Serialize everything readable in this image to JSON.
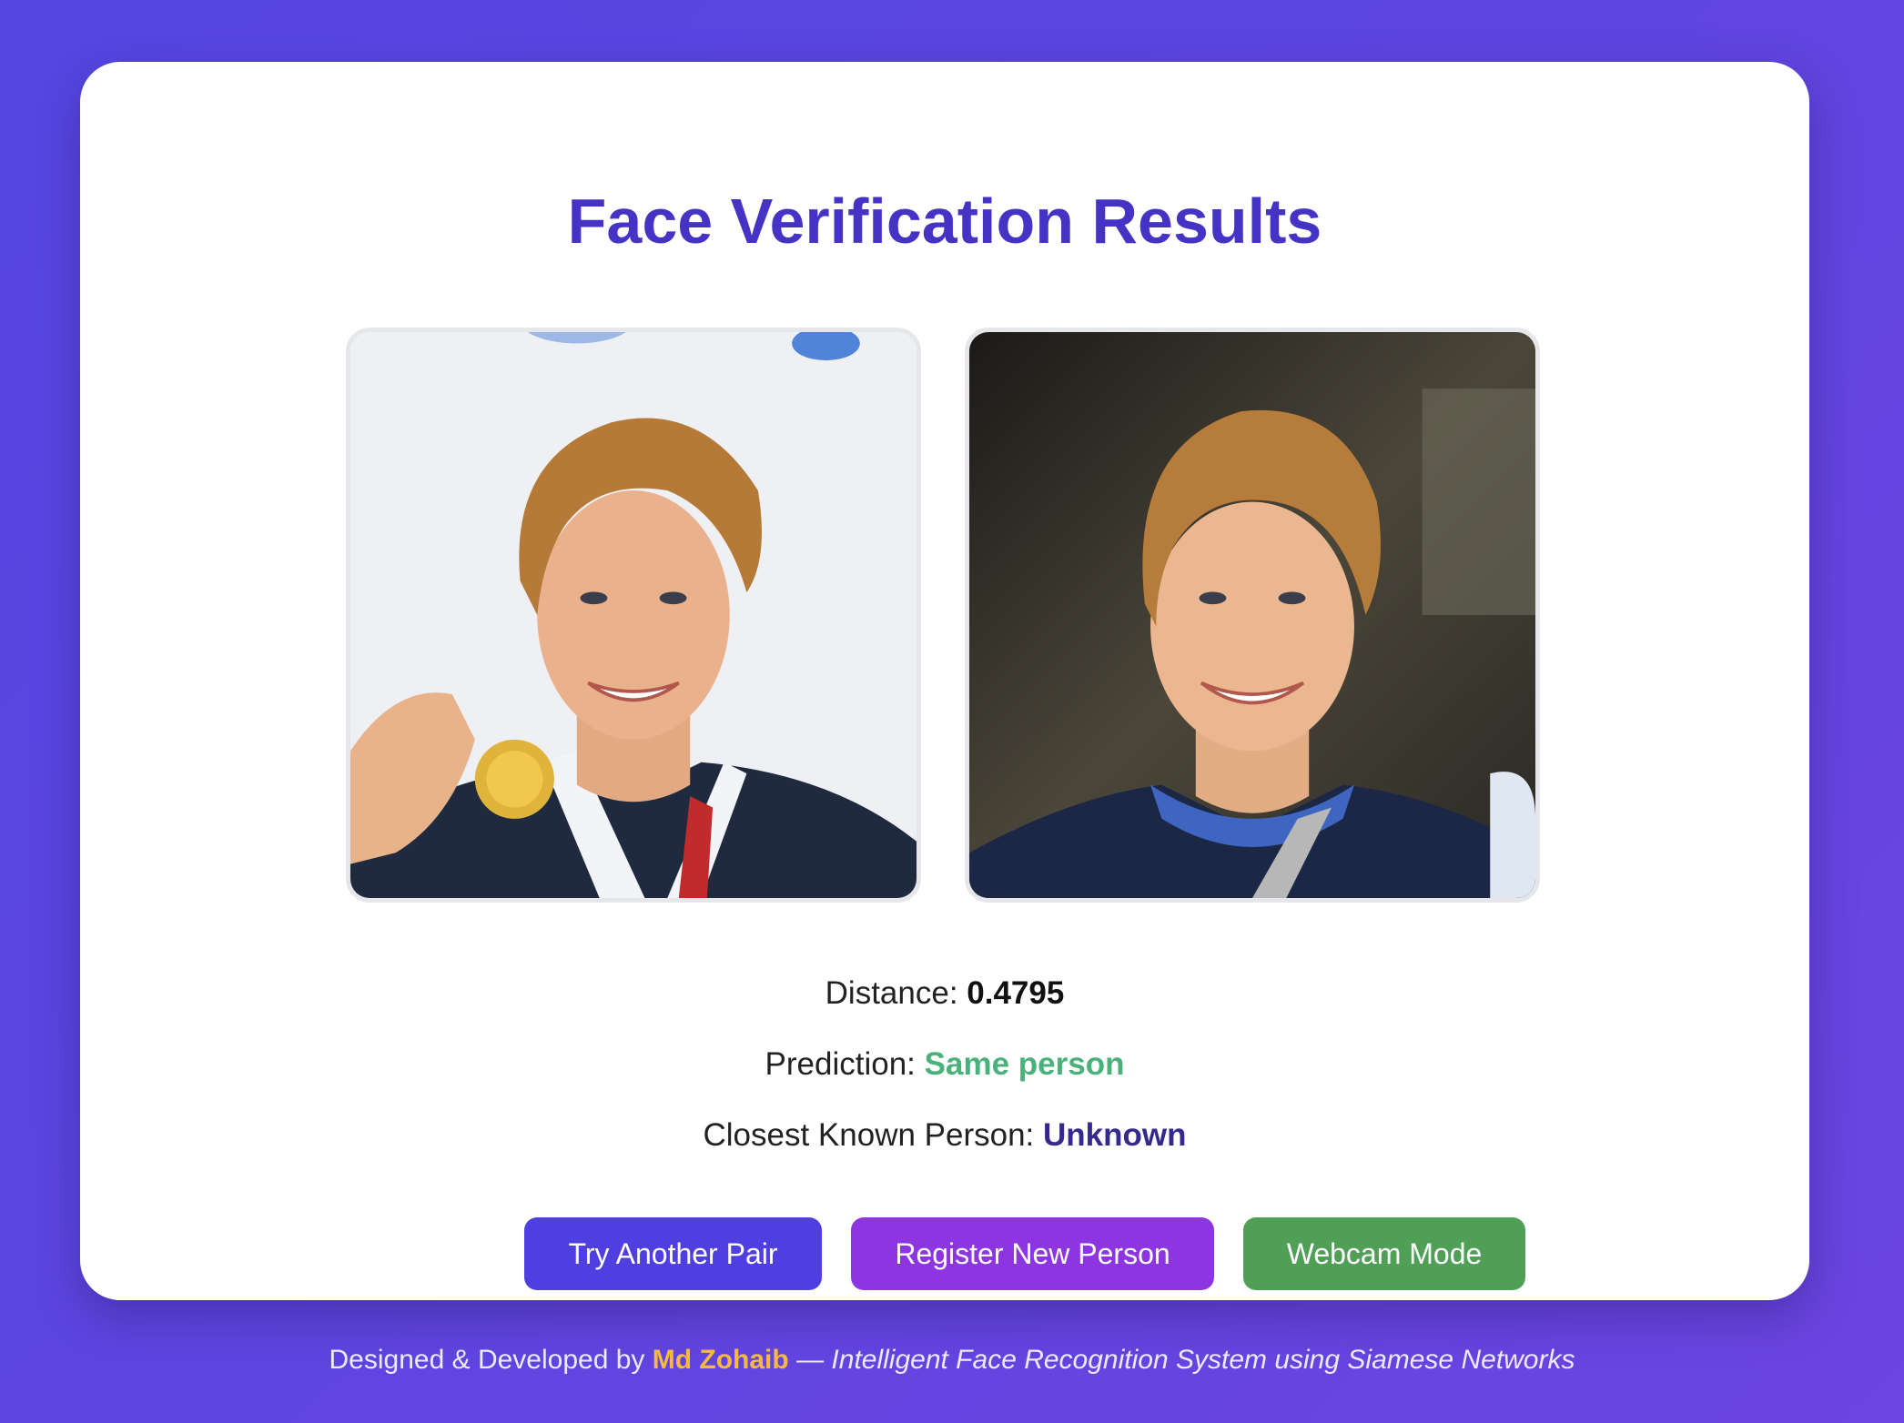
{
  "page": {
    "title": "Face Verification Results"
  },
  "images": {
    "left_alt": "Input face image 1",
    "right_alt": "Input face image 2"
  },
  "results": {
    "distance_label": "Distance:",
    "distance_value": "0.4795",
    "prediction_label": "Prediction:",
    "prediction_value": "Same person",
    "closest_label": "Closest Known Person:",
    "closest_value": "Unknown"
  },
  "actions": {
    "try_another": "Try Another Pair",
    "register_new": "Register New Person",
    "webcam_mode": "Webcam Mode"
  },
  "footer": {
    "prefix": "Designed & Developed by",
    "author": "Md Zohaib",
    "separator": "—",
    "tagline": "Intelligent Face Recognition System using Siamese Networks"
  },
  "colors": {
    "background_start": "#5546e2",
    "background_end": "#6c44e0",
    "title": "#4433c4",
    "prediction_same": "#48b27a",
    "closest": "#35288f",
    "button_try": "#4f3fe0",
    "button_register": "#8c35e0",
    "button_webcam": "#4fa056",
    "footer_author": "#f5b942"
  }
}
